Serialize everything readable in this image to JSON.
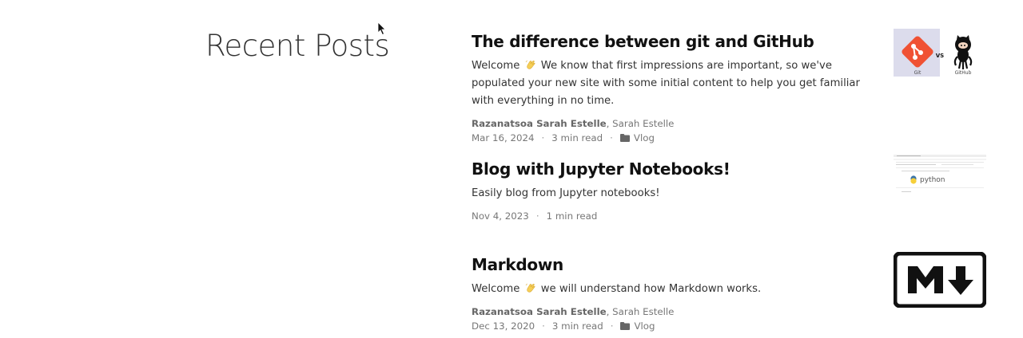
{
  "section_title": "Recent Posts",
  "posts": [
    {
      "title": "The difference between git and GitHub",
      "summary_prefix": "Welcome",
      "emoji_icon": "waving-hand-icon",
      "summary_rest": "We know that first impressions are important, so we've populated your new site with some initial content to help you get familiar with everything in no time.",
      "author_primary": "Razanatsoa Sarah Estelle",
      "author_secondary": ", Sarah Estelle",
      "date": "Mar 16, 2024",
      "read_time": "3 min read",
      "category": "Vlog",
      "thumbnail": {
        "icon": "git-vs-github-thumbnail",
        "label_left": "Git",
        "label_mid": "VS",
        "label_right": "GitHub"
      }
    },
    {
      "title": "Blog with Jupyter Notebooks!",
      "summary_prefix": "Easily blog from Jupyter notebooks!",
      "date": "Nov 4, 2023",
      "read_time": "1 min read",
      "thumbnail": {
        "icon": "python-notebook-thumbnail",
        "label": "python"
      }
    },
    {
      "title": "Markdown",
      "summary_prefix": "Welcome",
      "emoji_icon": "waving-hand-icon",
      "summary_rest": "we will understand how Markdown works.",
      "author_primary": "Razanatsoa Sarah Estelle",
      "author_secondary": ", Sarah Estelle",
      "date": "Dec 13, 2020",
      "read_time": "3 min read",
      "category": "Vlog",
      "thumbnail": {
        "icon": "markdown-logo-thumbnail"
      }
    }
  ],
  "colors": {
    "git_orange": "#f05133",
    "thumb_bg_left": "#dcdcec",
    "emoji_yellow": "#f6cf57"
  }
}
